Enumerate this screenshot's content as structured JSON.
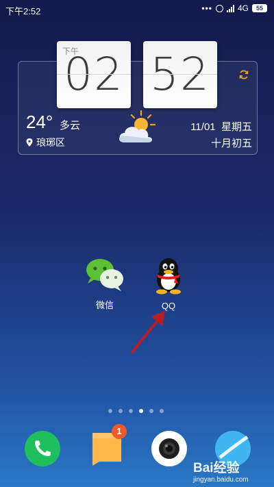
{
  "status_bar": {
    "time": "下午2:52",
    "network": "4G",
    "battery": "55",
    "icons": [
      "more-dots-icon",
      "alarm-icon",
      "signal-icon",
      "battery-icon"
    ]
  },
  "clock_widget": {
    "ampm": "下午",
    "hour": "02",
    "minute": "52",
    "refresh_icon": "refresh-icon"
  },
  "weather": {
    "temperature": "24°",
    "condition": "多云",
    "location": "琅琊区",
    "date": "11/01",
    "weekday": "星期五",
    "lunar_date": "十月初五",
    "icon": "partly-cloudy-icon"
  },
  "apps": [
    {
      "label": "微信",
      "icon": "wechat-icon"
    },
    {
      "label": "QQ",
      "icon": "qq-icon"
    }
  ],
  "page_indicator": {
    "count": 6,
    "active_index": 3
  },
  "dock": [
    {
      "name": "phone",
      "icon": "phone-icon"
    },
    {
      "name": "messages",
      "icon": "message-icon",
      "badge": "1"
    },
    {
      "name": "camera",
      "icon": "camera-icon"
    },
    {
      "name": "browser",
      "icon": "browser-icon"
    }
  ],
  "watermark": {
    "title": "Bai经验",
    "url": "jingyan.baidu.com"
  },
  "colors": {
    "arrow": "#b81e24",
    "badge": "#f05a2a",
    "phone_bg": "#1fbf5e"
  }
}
